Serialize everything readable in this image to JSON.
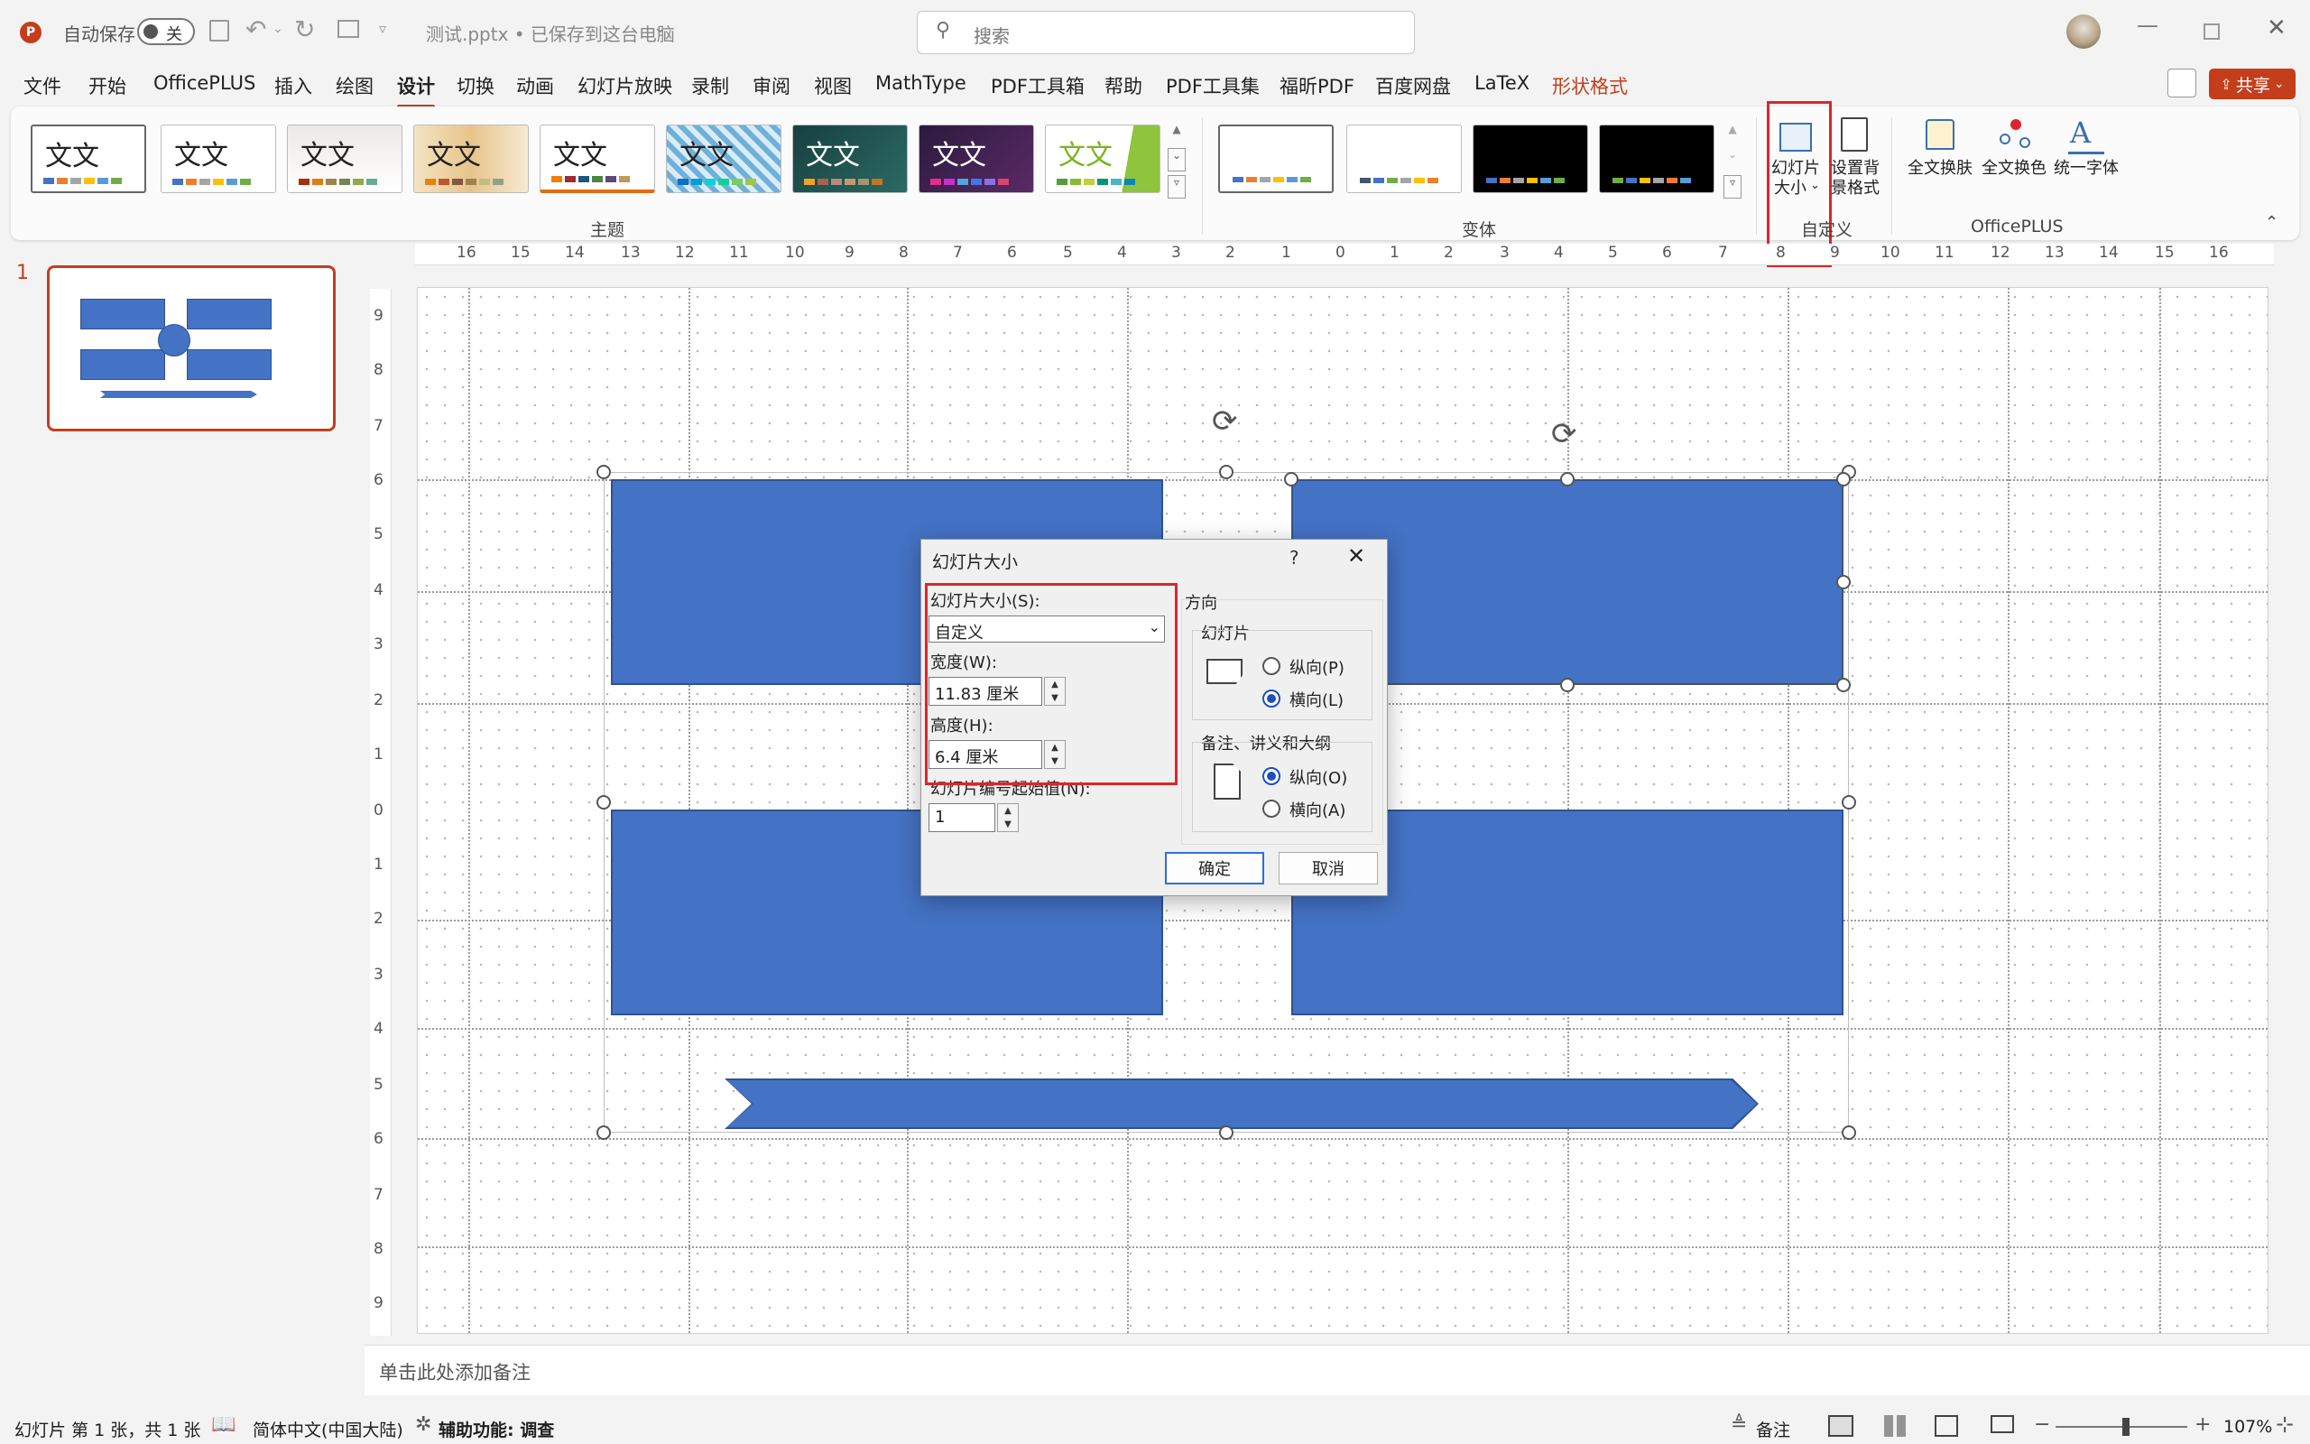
{
  "titlebar": {
    "autosave_label": "自动保存",
    "autosave_state": "关",
    "file_title": "测试.pptx • 已保存到这台电脑",
    "search_placeholder": "搜索"
  },
  "menu": [
    "文件",
    "开始",
    "OfficePLUS",
    "插入",
    "绘图",
    "设计",
    "切换",
    "动画",
    "幻灯片放映",
    "录制",
    "审阅",
    "视图",
    "MathType",
    "PDF工具箱",
    "帮助",
    "PDF工具集",
    "福昕PDF",
    "百度网盘",
    "LaTeX",
    "形状格式"
  ],
  "menu_active": "设计",
  "share_label": "共享",
  "ribbon": {
    "theme_text": "文文",
    "theme_group_label": "主题",
    "variant_group_label": "变体",
    "custom_group_label": "自定义",
    "officeplus_group_label": "OfficePLUS",
    "slide_size_label_1": "幻灯片",
    "slide_size_label_2": "大小",
    "bg_format_label_1": "设置背",
    "bg_format_label_2": "景格式",
    "skin_label": "全文换肤",
    "recolor_label": "全文换色",
    "font_label": "统一字体"
  },
  "ruler_h": [
    "16",
    "15",
    "14",
    "13",
    "12",
    "11",
    "10",
    "9",
    "8",
    "7",
    "6",
    "5",
    "4",
    "3",
    "2",
    "1",
    "0",
    "1",
    "2",
    "3",
    "4",
    "5",
    "6",
    "7",
    "8",
    "9",
    "10",
    "11",
    "12",
    "13",
    "14",
    "15",
    "16"
  ],
  "ruler_v": [
    "9",
    "8",
    "7",
    "6",
    "5",
    "4",
    "3",
    "2",
    "1",
    "0",
    "1",
    "2",
    "3",
    "4",
    "5",
    "6",
    "7",
    "8",
    "9"
  ],
  "thumb_number": "1",
  "dialog": {
    "title": "幻灯片大小",
    "help": "?",
    "size_label": "幻灯片大小(S):",
    "size_value": "自定义",
    "width_label": "宽度(W):",
    "width_value": "11.83 厘米",
    "height_label": "高度(H):",
    "height_value": "6.4 厘米",
    "start_label": "幻灯片编号起始值(N):",
    "start_value": "1",
    "orientation_label": "方向",
    "slides_group": "幻灯片",
    "slides_portrait": "纵向(P)",
    "slides_landscape": "横向(L)",
    "notes_group": "备注、讲义和大纲",
    "notes_portrait": "纵向(O)",
    "notes_landscape": "横向(A)",
    "ok": "确定",
    "cancel": "取消"
  },
  "notes_placeholder": "单击此处添加备注",
  "status": {
    "slide_info": "幻灯片 第 1 张，共 1 张",
    "language": "简体中文(中国大陆)",
    "accessibility": "辅助功能: 调查",
    "notes_btn": "备注",
    "zoom": "107%"
  },
  "colors": {
    "accent": "#c43e1c",
    "shape_fill": "#4472c4",
    "highlight": "#e0242b"
  }
}
